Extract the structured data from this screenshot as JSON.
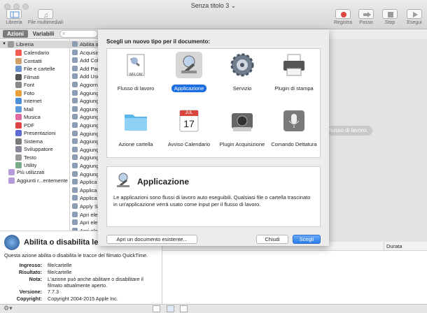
{
  "window": {
    "title": "Senza titolo 3"
  },
  "toolbar": {
    "library": "Libreria",
    "media": "File multimediali",
    "record": "Registra",
    "step": "Passo",
    "stop": "Stop",
    "run": "Esegui"
  },
  "tabs": {
    "actions": "Azioni",
    "variables": "Variabili"
  },
  "library": {
    "root": "Libreria",
    "items": [
      "Calendario",
      "Contatti",
      "File e cartelle",
      "Filmati",
      "Font",
      "Foto",
      "Internet",
      "Mail",
      "Musica",
      "PDF",
      "Presentazioni",
      "Sistema",
      "Sviluppatore",
      "Testo",
      "Utility"
    ],
    "most_used": "Più utilizzati",
    "recent": "Aggiunti r...entemente"
  },
  "actions_list": [
    "Abilita o",
    "Acquisis",
    "Add Col",
    "Add Pac",
    "Add Use",
    "Aggiorn",
    "Aggiung",
    "Aggiung",
    "Aggiung",
    "Aggiung",
    "Aggiung",
    "Aggiung",
    "Aggiung",
    "Aggiung",
    "Aggiung",
    "Aggiung",
    "Aggiung",
    "Applica",
    "Applica",
    "Applica",
    "Apply S",
    "Apri ele",
    "Apri ele",
    "Apri ele"
  ],
  "workflow": {
    "drag_hint": "flusso di lavoro."
  },
  "sheet": {
    "heading": "Scegli un nuovo tipo per il documento:",
    "types": [
      {
        "label": "Flusso di lavoro",
        "icon": "workflow-icon"
      },
      {
        "label": "Applicazione",
        "icon": "application-icon"
      },
      {
        "label": "Servizio",
        "icon": "service-gear-icon"
      },
      {
        "label": "Plugin di stampa",
        "icon": "printer-icon"
      },
      {
        "label": "Azione cartella",
        "icon": "folder-icon"
      },
      {
        "label": "Avviso Calendario",
        "icon": "calendar-icon"
      },
      {
        "label": "Plugin Acquisizione",
        "icon": "camera-icon"
      },
      {
        "label": "Comando Dettatura",
        "icon": "microphone-icon"
      }
    ],
    "wflow_badge": "WFLOW",
    "cal_month": "JUL",
    "cal_day": "17",
    "desc_title": "Applicazione",
    "desc_text": "Le applicazioni sono flussi di lavoro auto eseguibili. Qualsiasi file o cartella trascinato in un'applicazione verrà usato come input per il flusso di lavoro.",
    "open_existing": "Apri un documento esistente...",
    "close": "Chiudi",
    "choose": "Scegli"
  },
  "info": {
    "title": "Abilita o disabilita le",
    "description": "Questa azione abilita o disabilita le tracce del filmato QuickTime.",
    "input_label": "Ingresso:",
    "input_value": "file/cartelle",
    "result_label": "Risultato:",
    "result_value": "file/cartelle",
    "note_label": "Nota:",
    "note_value": "L'azione può anche abilitare o disabilitare il filmato attualmente aperto.",
    "version_label": "Versione:",
    "version_value": "7.7.3",
    "copyright_label": "Copyright:",
    "copyright_value": "Copyright 2004-2015 Apple Inc."
  },
  "log": {
    "duration": "Durata"
  },
  "colors": {
    "accent": "#1c6fe0",
    "record": "#e0443f"
  }
}
